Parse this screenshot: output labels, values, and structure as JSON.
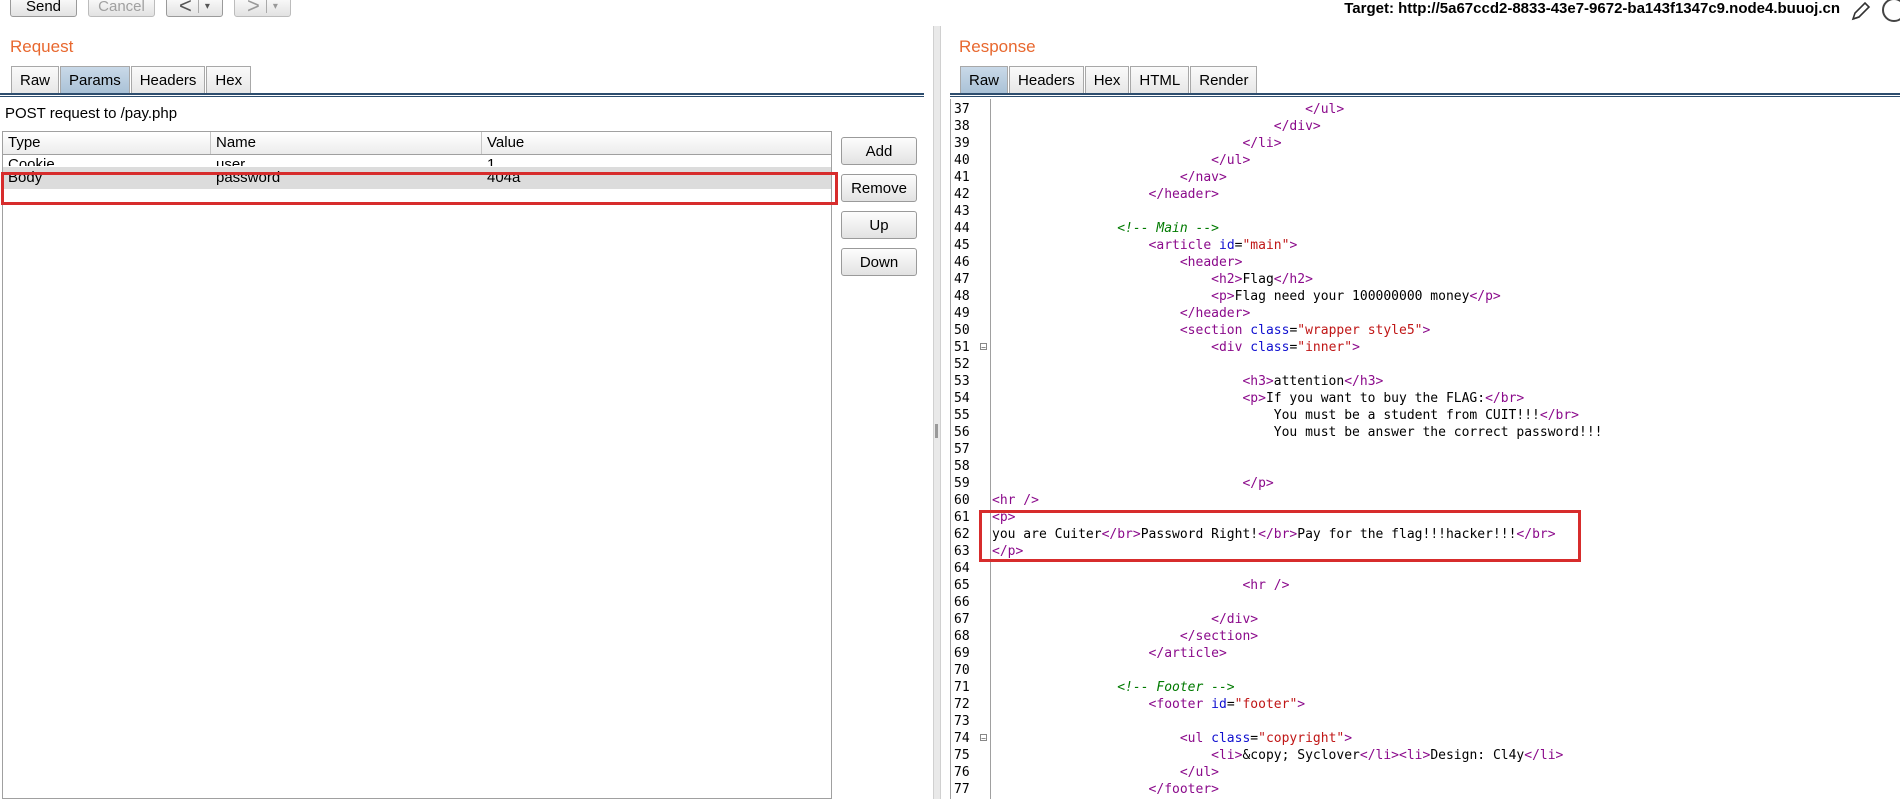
{
  "toolbar": {
    "send": "Send",
    "cancel": "Cancel",
    "back": "<",
    "forward": ">",
    "dropdown": "▾",
    "target_label": "Target: http://5a67ccd2-8833-43e7-9672-ba143f1347c9.node4.buuoj.cn"
  },
  "request": {
    "title": "Request",
    "tabs": [
      "Raw",
      "Params",
      "Headers",
      "Hex"
    ],
    "active_tab": "Params",
    "summary": "POST request to /pay.php",
    "columns": [
      "Type",
      "Name",
      "Value"
    ],
    "rows": [
      {
        "type": "Cookie",
        "name": "user",
        "value": "1"
      },
      {
        "type": "Body",
        "name": "password",
        "value": "404a"
      }
    ],
    "buttons": [
      "Add",
      "Remove",
      "Up",
      "Down"
    ]
  },
  "response": {
    "title": "Response",
    "tabs": [
      "Raw",
      "Headers",
      "Hex",
      "HTML",
      "Render"
    ],
    "active_tab": "Raw",
    "lines": [
      {
        "n": "37",
        "parts": [
          [
            "",
            "                                        "
          ],
          [
            "tag",
            "</ul>"
          ]
        ]
      },
      {
        "n": "38",
        "parts": [
          [
            "",
            "                                    "
          ],
          [
            "tag",
            "</div>"
          ]
        ]
      },
      {
        "n": "39",
        "parts": [
          [
            "",
            "                                "
          ],
          [
            "tag",
            "</li>"
          ]
        ]
      },
      {
        "n": "40",
        "parts": [
          [
            "",
            "                            "
          ],
          [
            "tag",
            "</ul>"
          ]
        ]
      },
      {
        "n": "41",
        "parts": [
          [
            "",
            "                        "
          ],
          [
            "tag",
            "</nav>"
          ]
        ]
      },
      {
        "n": "42",
        "parts": [
          [
            "",
            "                    "
          ],
          [
            "tag",
            "</header>"
          ]
        ]
      },
      {
        "n": "43",
        "parts": []
      },
      {
        "n": "44",
        "parts": [
          [
            "",
            "                "
          ],
          [
            "cmt",
            "<!-- Main -->"
          ]
        ]
      },
      {
        "n": "45",
        "parts": [
          [
            "",
            "                    "
          ],
          [
            "tag",
            "<article "
          ],
          [
            "attr",
            "id"
          ],
          [
            "",
            "="
          ],
          [
            "val",
            "\"main\""
          ],
          [
            "tag",
            ">"
          ]
        ]
      },
      {
        "n": "46",
        "parts": [
          [
            "",
            "                        "
          ],
          [
            "tag",
            "<header>"
          ]
        ]
      },
      {
        "n": "47",
        "parts": [
          [
            "",
            "                            "
          ],
          [
            "tag",
            "<h2>"
          ],
          [
            "",
            "Flag"
          ],
          [
            "tag",
            "</h2>"
          ]
        ]
      },
      {
        "n": "48",
        "parts": [
          [
            "",
            "                            "
          ],
          [
            "tag",
            "<p>"
          ],
          [
            "",
            "Flag need your 100000000 money"
          ],
          [
            "tag",
            "</p>"
          ]
        ]
      },
      {
        "n": "49",
        "parts": [
          [
            "",
            "                        "
          ],
          [
            "tag",
            "</header>"
          ]
        ]
      },
      {
        "n": "50",
        "parts": [
          [
            "",
            "                        "
          ],
          [
            "tag",
            "<section "
          ],
          [
            "attr",
            "class"
          ],
          [
            "",
            "="
          ],
          [
            "val",
            "\"wrapper style5\""
          ],
          [
            "tag",
            ">"
          ]
        ]
      },
      {
        "n": "51",
        "fold": true,
        "parts": [
          [
            "",
            "                            "
          ],
          [
            "tag",
            "<div "
          ],
          [
            "attr",
            "class"
          ],
          [
            "",
            "="
          ],
          [
            "val",
            "\"inner\""
          ],
          [
            "tag",
            ">"
          ]
        ]
      },
      {
        "n": "52",
        "parts": []
      },
      {
        "n": "53",
        "parts": [
          [
            "",
            "                                "
          ],
          [
            "tag",
            "<h3>"
          ],
          [
            "",
            "attention"
          ],
          [
            "tag",
            "</h3>"
          ]
        ]
      },
      {
        "n": "54",
        "parts": [
          [
            "",
            "                                "
          ],
          [
            "tag",
            "<p>"
          ],
          [
            "",
            "If you want to buy the FLAG:"
          ],
          [
            "tag",
            "</br>"
          ]
        ]
      },
      {
        "n": "55",
        "parts": [
          [
            "",
            "                                    You must be a student from CUIT!!!"
          ],
          [
            "tag",
            "</br>"
          ]
        ]
      },
      {
        "n": "56",
        "parts": [
          [
            "",
            "                                    You must be answer the correct password!!!"
          ]
        ]
      },
      {
        "n": "57",
        "parts": []
      },
      {
        "n": "58",
        "parts": []
      },
      {
        "n": "59",
        "parts": [
          [
            "",
            "                                "
          ],
          [
            "tag",
            "</p>"
          ]
        ]
      },
      {
        "n": "60",
        "parts": [
          [
            "tag",
            "<hr />"
          ]
        ]
      },
      {
        "n": "61",
        "parts": [
          [
            "tag",
            "<p>"
          ]
        ]
      },
      {
        "n": "62",
        "parts": [
          [
            "",
            "you are Cuiter"
          ],
          [
            "tag",
            "</br>"
          ],
          [
            "",
            "Password Right!"
          ],
          [
            "tag",
            "</br>"
          ],
          [
            "",
            "Pay for the flag!!!hacker!!!"
          ],
          [
            "tag",
            "</br>"
          ]
        ]
      },
      {
        "n": "63",
        "parts": [
          [
            "tag",
            "</p>"
          ]
        ]
      },
      {
        "n": "64",
        "parts": []
      },
      {
        "n": "65",
        "parts": [
          [
            "",
            "                                "
          ],
          [
            "tag",
            "<hr />"
          ]
        ]
      },
      {
        "n": "66",
        "parts": []
      },
      {
        "n": "67",
        "parts": [
          [
            "",
            "                            "
          ],
          [
            "tag",
            "</div>"
          ]
        ]
      },
      {
        "n": "68",
        "parts": [
          [
            "",
            "                        "
          ],
          [
            "tag",
            "</section>"
          ]
        ]
      },
      {
        "n": "69",
        "parts": [
          [
            "",
            "                    "
          ],
          [
            "tag",
            "</article>"
          ]
        ]
      },
      {
        "n": "70",
        "parts": []
      },
      {
        "n": "71",
        "parts": [
          [
            "",
            "                "
          ],
          [
            "cmt",
            "<!-- Footer -->"
          ]
        ]
      },
      {
        "n": "72",
        "parts": [
          [
            "",
            "                    "
          ],
          [
            "tag",
            "<footer "
          ],
          [
            "attr",
            "id"
          ],
          [
            "",
            "="
          ],
          [
            "val",
            "\"footer\""
          ],
          [
            "tag",
            ">"
          ]
        ]
      },
      {
        "n": "73",
        "parts": []
      },
      {
        "n": "74",
        "fold": true,
        "parts": [
          [
            "",
            "                        "
          ],
          [
            "tag",
            "<ul "
          ],
          [
            "attr",
            "class"
          ],
          [
            "",
            "="
          ],
          [
            "val",
            "\"copyright\""
          ],
          [
            "tag",
            ">"
          ]
        ]
      },
      {
        "n": "75",
        "parts": [
          [
            "",
            "                            "
          ],
          [
            "tag",
            "<li>"
          ],
          [
            "",
            "&copy; Syclover"
          ],
          [
            "tag",
            "</li><li>"
          ],
          [
            "",
            "Design: Cl4y"
          ],
          [
            "tag",
            "</li>"
          ]
        ]
      },
      {
        "n": "76",
        "parts": [
          [
            "",
            "                        "
          ],
          [
            "tag",
            "</ul>"
          ]
        ]
      },
      {
        "n": "77",
        "parts": [
          [
            "",
            "                    "
          ],
          [
            "tag",
            "</footer>"
          ]
        ]
      }
    ]
  }
}
